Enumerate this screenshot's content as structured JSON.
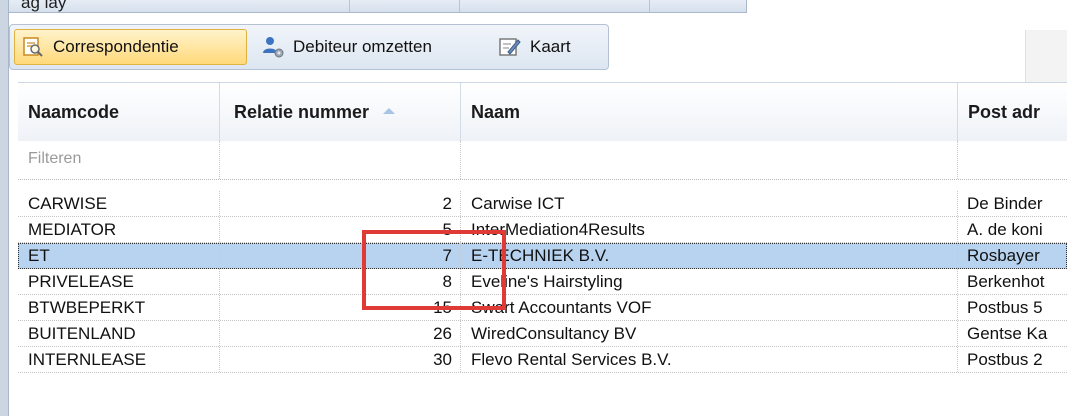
{
  "top_strip": {
    "label": "ag lay"
  },
  "toolbar": {
    "buttons": [
      {
        "label": "Correspondentie",
        "icon": "search-document-icon"
      },
      {
        "label": "Debiteur omzetten",
        "icon": "user-gear-icon"
      },
      {
        "label": "Kaart",
        "icon": "edit-card-icon"
      }
    ]
  },
  "grid": {
    "columns": [
      "Naamcode",
      "Relatie nummer",
      "Naam",
      "Post adr"
    ],
    "sort_column": "Relatie nummer",
    "filter_placeholder": "Filteren",
    "rows": [
      {
        "code": "CARWISE",
        "number": "2",
        "name": "Carwise ICT",
        "post": "De Binder"
      },
      {
        "code": "MEDIATOR",
        "number": "5",
        "name": "InterMediation4Results",
        "post": "A. de koni"
      },
      {
        "code": "ET",
        "number": "7",
        "name": "E-TECHNIEK B.V.",
        "post": "Rosbayer"
      },
      {
        "code": "PRIVELEASE",
        "number": "8",
        "name": "Eveline's Hairstyling",
        "post": "Berkenhot"
      },
      {
        "code": "BTWBEPERKT",
        "number": "15",
        "name": "Swart Accountants VOF",
        "post": "Postbus 5"
      },
      {
        "code": "BUITENLAND",
        "number": "26",
        "name": "WiredConsultancy BV",
        "post": "Gentse Ka"
      },
      {
        "code": "INTERNLEASE",
        "number": "30",
        "name": "Flevo Rental Services B.V.",
        "post": "Postbus 2"
      }
    ],
    "selected_row_index": 2
  },
  "colors": {
    "selection": "#b8d3f0",
    "highlight_border": "#e03a36",
    "active_button": "#ffd97a"
  }
}
